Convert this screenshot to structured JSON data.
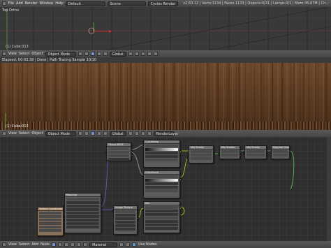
{
  "topbar": {
    "menus": [
      "File",
      "Add",
      "Render",
      "Window",
      "Help"
    ],
    "layout": "Default",
    "scene": "Scene",
    "engine": "Cycles Render",
    "stats": "v2.63.12 | Verts:1134 | Faces:1133 | Objects:0/21 | Lamps:0/1 | Mem:35.67M | Ch..."
  },
  "viewport": {
    "label": "Top Ortho",
    "object_label": "(1) Cube.013"
  },
  "header1": {
    "menus": [
      "View",
      "Select",
      "Object"
    ],
    "mode": "Object Mode",
    "orientation": "Global"
  },
  "render_view": {
    "status": "Elapsed: 00:03.38 | Done | Path Tracing Sample 10/10",
    "object_label": "(1) Cube.013"
  },
  "header2": {
    "menus": [
      "View",
      "Select",
      "Object"
    ],
    "mode": "Object Mode",
    "orientation": "Global",
    "layer": "RenderLayer"
  },
  "node_editor": {
    "nodes": {
      "texcoord": "Texture Coordinate",
      "mapping": "Mapping",
      "diffuse": "Glossy BSDF",
      "wave": "Wave Texture",
      "mix1": "ColorRamp",
      "mix2": "ColorRamp",
      "noise": "Image Texture",
      "bump": "Mix",
      "mixshader": "Mix Shader",
      "glossy": "Mix Shader",
      "output": "Material Output"
    }
  },
  "header3": {
    "menus": [
      "View",
      "Select",
      "Add",
      "Node"
    ],
    "material": "Material",
    "use_nodes": "Use Nodes"
  }
}
